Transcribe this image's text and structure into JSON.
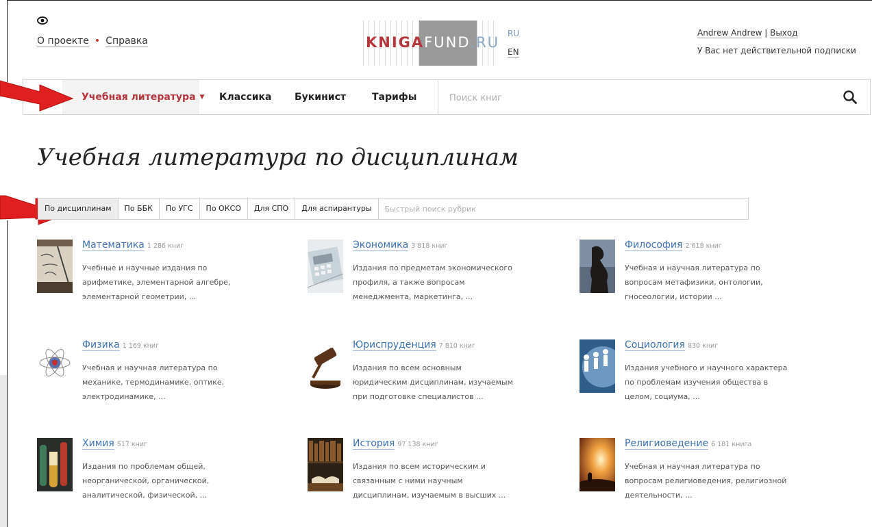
{
  "header": {
    "eye_icon": "eye-icon",
    "links": [
      "О проекте",
      "Справка"
    ],
    "logo": {
      "part1": "KNIGA",
      "part2": "FUND",
      "part3": ".RU"
    },
    "languages": [
      "RU",
      "EN"
    ],
    "user": {
      "name": "Andrew Andrew",
      "separator": " | ",
      "logout": "Выход"
    },
    "subscription": "У Вас нет действительной подписки"
  },
  "nav": {
    "items": [
      "Учебная литература",
      "Классика",
      "Букинист",
      "Тарифы"
    ],
    "search_placeholder": "Поиск книг"
  },
  "page": {
    "title": "Учебная литература по дисциплинам",
    "filter_tabs": [
      "По дисциплинам",
      "По ББК",
      "По УГС",
      "По ОКСО",
      "Для СПО",
      "Для аспирантуры"
    ],
    "filter_placeholder": "Быстрый поиск рубрик"
  },
  "categories": [
    {
      "name": "Математика",
      "count": "1 286 книг",
      "desc": "Учебные и научные издания по арифметике, элементарной алгебре, элементарной геометрии, ..."
    },
    {
      "name": "Экономика",
      "count": "3 818 книг",
      "desc": "Издания по предметам экономического профиля, а также вопросам менеджмента, маркетинга, ..."
    },
    {
      "name": "Философия",
      "count": "2 618 книг",
      "desc": "Учебная и научная литература по вопросам метафизики, онтологии, гносеологии, истории ..."
    },
    {
      "name": "Физика",
      "count": "1 169 книг",
      "desc": "Учебная и научная литература по механике, термодинамике, оптике, электродинамике, ..."
    },
    {
      "name": "Юриспруденция",
      "count": "7 810 книг",
      "desc": "Издания по всем основным юридическим дисциплинам, изучаемым при подготовке специалистов ..."
    },
    {
      "name": "Социология",
      "count": "830 книг",
      "desc": "Издания учебного и научного характера по проблемам изучения общества в целом, социума, ..."
    },
    {
      "name": "Химия",
      "count": "517 книг",
      "desc": "Издания по проблемам общей, неорганической, органической, аналитической, физической, ..."
    },
    {
      "name": "История",
      "count": "97 138 книг",
      "desc": "Издания по всем историческим и связанным с ними научным дисциплинам, изучаемым в высших ..."
    },
    {
      "name": "Религиоведение",
      "count": "6 181 книга",
      "desc": "Учебная и научная литература по вопросам религиоведения, религиозной деятельности, ..."
    }
  ],
  "colors": {
    "accent": "#b5373b",
    "link": "#3d72b0",
    "arrow": "#e02020"
  }
}
